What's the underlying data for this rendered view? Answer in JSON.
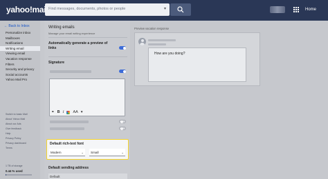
{
  "header": {
    "logo": "yahoo!mail",
    "search_placeholder": "Find messages, documents, photos or people",
    "home_label": "Home"
  },
  "sidebar": {
    "back_link": "Back to Inbox",
    "items": [
      {
        "label": "Personalize inbox",
        "active": false
      },
      {
        "label": "Mailboxes",
        "active": false
      },
      {
        "label": "Notifications",
        "active": false
      },
      {
        "label": "Writing email",
        "active": true
      },
      {
        "label": "Viewing email",
        "active": false
      },
      {
        "label": "Vacation response",
        "active": false
      },
      {
        "label": "Filters",
        "active": false
      },
      {
        "label": "Security and privacy",
        "active": false
      },
      {
        "label": "Social accounts",
        "active": false
      },
      {
        "label": "Yahoo Mail Pro",
        "active": false
      }
    ],
    "footer_links": [
      "Switch to basic Mail",
      "About Yahoo Mail",
      "About our Ads",
      "Give feedback",
      "Help",
      "Privacy Policy",
      "Privacy dashboard",
      "Terms"
    ],
    "storage_label": "1 TB of storage",
    "storage_used": "0.44 % used",
    "storage_fraction": 0.0044
  },
  "settings": {
    "title": "Writing emails",
    "subtitle": "Manage your email writing experience",
    "preview_links_label": "Automatically generate a preview of links",
    "preview_links_on": true,
    "signature_label": "Signature",
    "signature_toggle_on": true,
    "toolbar": {
      "link": "⚭",
      "bold": "B",
      "italic": "I",
      "font_size": "AA"
    },
    "default_font_label": "Default rich-text font",
    "font_face": "Modern",
    "font_size": "Small",
    "default_address_label": "Default sending address",
    "default_address_value": "Default"
  },
  "preview": {
    "title": "Preview vacation response",
    "reply_text": "How are you doing?"
  },
  "colors": {
    "topbar": "#2a3756",
    "highlight_border": "#f5d42b",
    "toggle_on": "#3d6cd8"
  }
}
